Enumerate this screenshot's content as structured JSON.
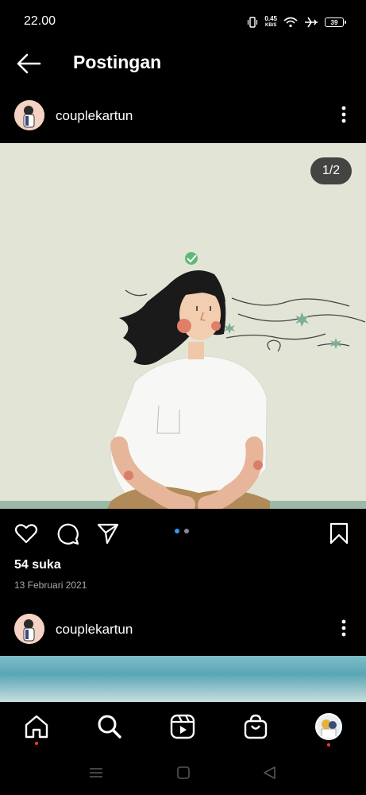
{
  "status_bar": {
    "time": "22.00",
    "net_speed_value": "0.45",
    "net_speed_unit": "KB/S",
    "battery": "39",
    "icons": [
      "vibrate-icon",
      "wifi-icon",
      "airplane-icon",
      "battery-icon"
    ]
  },
  "header": {
    "title": "Postingan",
    "back_icon": "arrow-left-icon"
  },
  "post": {
    "username": "couplekartun",
    "image_counter": "1/2",
    "image_description_icons": [
      "heart-check-icon"
    ],
    "likes": "54 suka",
    "date": "13 Februari 2021",
    "carousel": {
      "total": 2,
      "active": 1
    },
    "actions": [
      "heart-icon",
      "comment-icon",
      "share-icon",
      "bookmark-icon"
    ]
  },
  "next_post": {
    "username": "couplekartun"
  },
  "bottom_nav": {
    "items": [
      "home-icon",
      "search-icon",
      "reels-icon",
      "shop-icon",
      "profile-avatar"
    ]
  },
  "system_nav": {
    "items": [
      "menu-icon",
      "home-square-icon",
      "back-triangle-icon"
    ]
  },
  "colors": {
    "background": "#000000",
    "accent_blue": "#3897f0",
    "notification_red": "#ff3040",
    "image_background": "#e2e5d6"
  }
}
